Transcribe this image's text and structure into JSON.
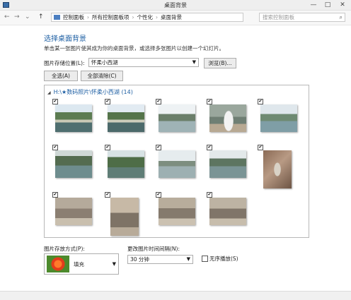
{
  "window": {
    "title": "桌面背景",
    "controls": {
      "minimize": "—",
      "maximize": "□",
      "close": "✕"
    }
  },
  "address_bar": {
    "nav": {
      "back": "←",
      "forward": "→",
      "dropdown": "⌄",
      "up": "↑"
    },
    "breadcrumbs": [
      "控制面板",
      "所有控制面板项",
      "个性化",
      "桌面背景"
    ],
    "separator": "›",
    "search_placeholder": "搜索控制面板",
    "search_icon": "⌕"
  },
  "main": {
    "heading": "选择桌面背景",
    "description": "单击某一张图片使其成为你的桌面背景，或选择多张图片以创建一个幻灯片。",
    "location_label": "图片存储位置(L):",
    "location_value": "怀柔小西湖",
    "browse_label": "浏览(B)...",
    "select_all_label": "全选(A)",
    "clear_all_label": "全部清除(C)",
    "folder_title": "H:\\★数码照片\\怀柔小西湖 (14)",
    "checkbox_mark": "✔"
  },
  "footer": {
    "position_label": "图片存放方式(P):",
    "position_value": "填充",
    "interval_label": "更改图片时间间隔(N):",
    "interval_value": "30 分钟",
    "shuffle_label": "无序播放(S)"
  }
}
